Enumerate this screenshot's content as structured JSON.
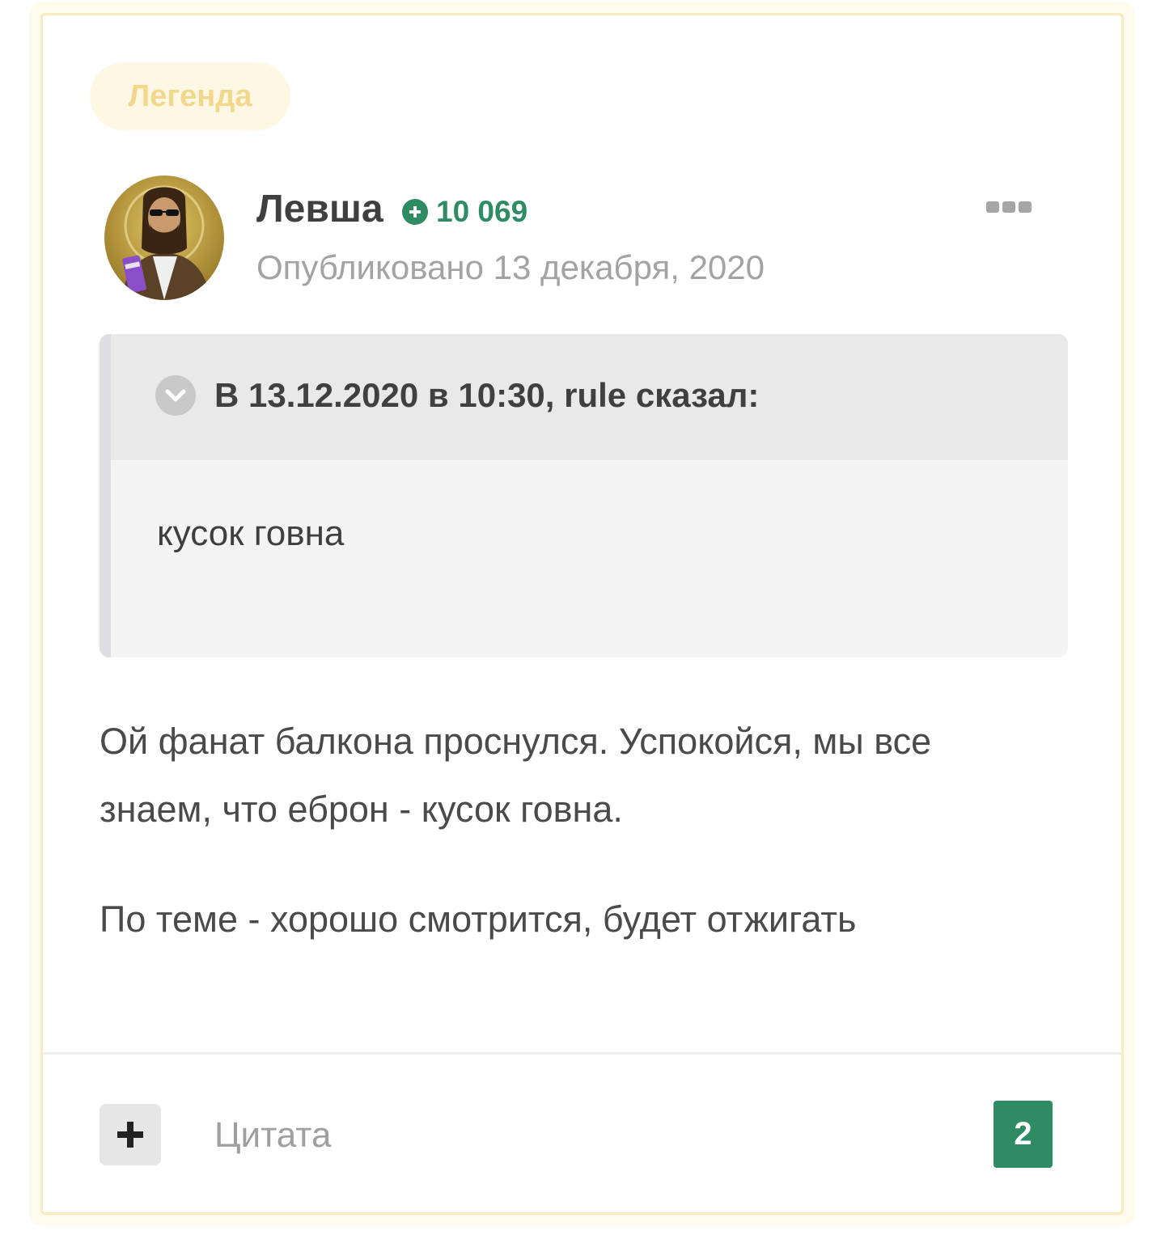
{
  "badge": {
    "label": "Легенда"
  },
  "author": {
    "name": "Левша",
    "reputation": "10 069",
    "date": "Опубликовано 13 декабря, 2020"
  },
  "quote": {
    "citation": "В 13.12.2020 в 10:30, rule сказал:",
    "text": "кусок говна"
  },
  "body": {
    "paragraph1": "Ой фанат балкона проснулся. Успокойся, мы все знаем, что еброн - кусок говна.",
    "paragraph2": "По теме - хорошо смотрится, будет отжигать"
  },
  "footer": {
    "quote_label": "Цитата",
    "reaction_count": "2"
  },
  "icons": {
    "reputation": "plus-circle-icon",
    "more": "more-horizontal-icon",
    "toggle": "chevron-down-icon",
    "add": "plus-icon"
  },
  "colors": {
    "accent_green": "#2e8b63",
    "legend_gold": "#f2d88d",
    "card_border": "#f7ebbf"
  }
}
